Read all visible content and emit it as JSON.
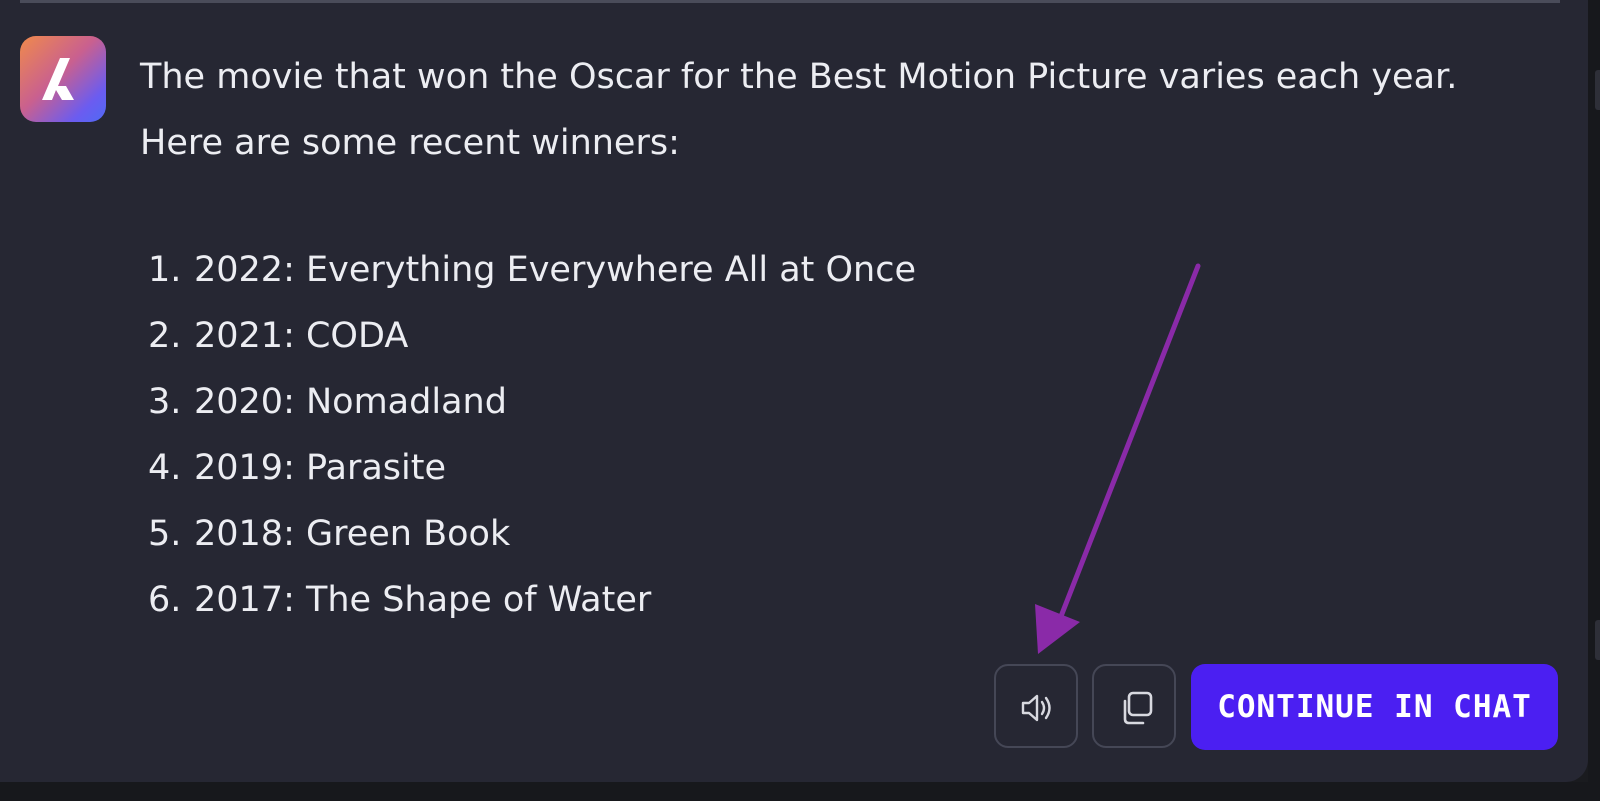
{
  "assistant": {
    "avatar_icon": "assistant-logo-icon",
    "message_line1": "The movie that won the Oscar for the Best Motion Picture varies each year.",
    "message_line2": "Here are some recent winners:",
    "winners": [
      {
        "number": "1.",
        "text": "2022: Everything Everywhere All at Once"
      },
      {
        "number": "2.",
        "text": "2021: CODA"
      },
      {
        "number": "3.",
        "text": "2020: Nomadland"
      },
      {
        "number": "4.",
        "text": "2019: Parasite"
      },
      {
        "number": "5.",
        "text": "2018: Green Book"
      },
      {
        "number": "6.",
        "text": "2017: The Shape of Water"
      }
    ]
  },
  "actions": {
    "speak_icon": "speaker-icon",
    "copy_icon": "copy-icon",
    "continue_label": "CONTINUE IN CHAT"
  },
  "annotation": {
    "arrow_color": "#8a2aa8",
    "points_to": "speak-button"
  },
  "colors": {
    "panel_bg": "#262733",
    "text": "#ecedf2",
    "accent": "#4b1ff2",
    "button_border": "#454756"
  }
}
